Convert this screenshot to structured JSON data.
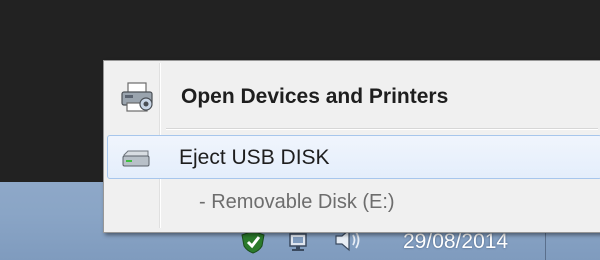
{
  "context_menu": {
    "items": [
      {
        "label": "Open Devices and Printers",
        "icon": "printer-icon",
        "bold": true
      },
      {
        "label": "Eject USB DISK",
        "icon": "usb-drive-icon",
        "highlighted": true
      },
      {
        "label": "- Removable Disk (E:)",
        "disabled": true
      }
    ]
  },
  "taskbar": {
    "tray_icons": [
      "security-shield-icon",
      "network-icon",
      "volume-icon"
    ],
    "clock": {
      "date": "29/08/2014"
    }
  },
  "colors": {
    "desktop": "#222222",
    "taskbar": "#8aa5c6",
    "menu_background": "#f0f0f0",
    "highlight_border": "#a7c6ec",
    "disabled_text": "#6d6d6d"
  }
}
